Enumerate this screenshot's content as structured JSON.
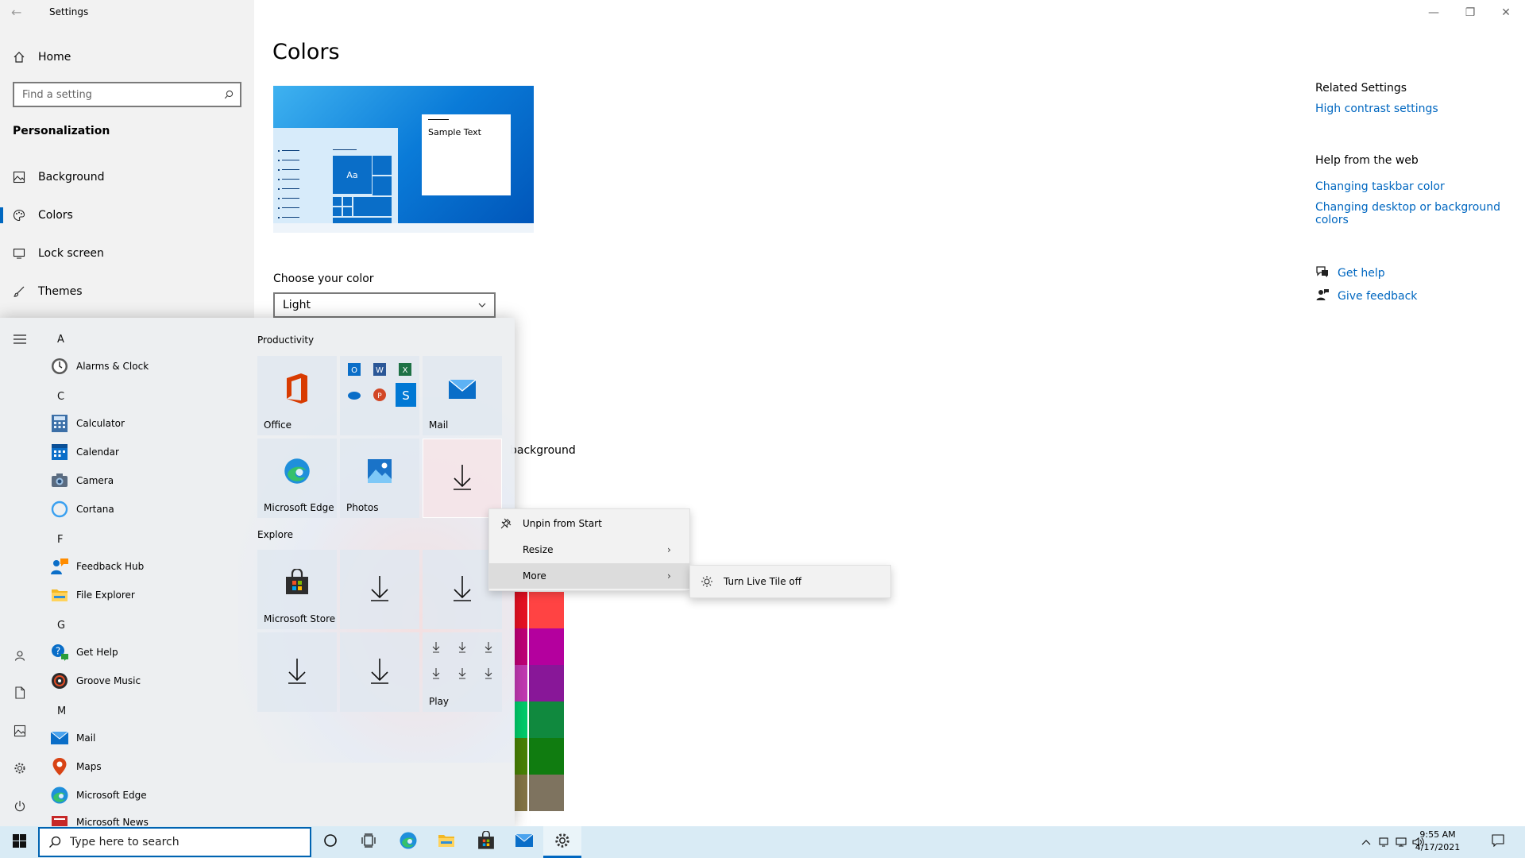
{
  "window": {
    "app_title": "Settings",
    "back_glyph": "←",
    "controls": {
      "minimize": "—",
      "restore": "❐",
      "close": "✕"
    }
  },
  "nav": {
    "home_label": "Home",
    "search_placeholder": "Find a setting",
    "section_label": "Personalization",
    "items": [
      {
        "label": "Background",
        "icon": "image-icon"
      },
      {
        "label": "Colors",
        "icon": "palette-icon",
        "active": true
      },
      {
        "label": "Lock screen",
        "icon": "monitor-icon"
      },
      {
        "label": "Themes",
        "icon": "brush-icon"
      }
    ]
  },
  "main": {
    "title": "Colors",
    "preview_sample_text": "Sample Text",
    "preview_tile_text": "Aa",
    "choose_color_label": "Choose your color",
    "choose_color_value": "Light",
    "partial_label": "background",
    "swatch_colors": [
      [
        "#e81123",
        "#ff4343"
      ],
      [
        "#bf0077",
        "#b4009e"
      ],
      [
        "#c239b3",
        "#881798"
      ],
      [
        "#00cc6a",
        "#10893e"
      ],
      [
        "#498205",
        "#107c10"
      ],
      [
        "#847545",
        "#7e735f"
      ]
    ]
  },
  "related": {
    "heading": "Related Settings",
    "high_contrast_link": "High contrast settings",
    "web_heading": "Help from the web",
    "taskbar_color_link": "Changing taskbar color",
    "desktop_color_link_line1": "Changing desktop or background",
    "desktop_color_link_line2": "colors",
    "get_help": "Get help",
    "give_feedback": "Give feedback"
  },
  "start_menu": {
    "letters": [
      "A",
      "C",
      "F",
      "G",
      "M"
    ],
    "apps": [
      {
        "label": "Alarms & Clock",
        "icon": "alarm-clock-icon"
      },
      {
        "label": "Calculator",
        "icon": "calculator-icon"
      },
      {
        "label": "Calendar",
        "icon": "calendar-icon"
      },
      {
        "label": "Camera",
        "icon": "camera-icon"
      },
      {
        "label": "Cortana",
        "icon": "cortana-icon"
      },
      {
        "label": "Feedback Hub",
        "icon": "feedback-hub-icon"
      },
      {
        "label": "File Explorer",
        "icon": "folder-icon"
      },
      {
        "label": "Get Help",
        "icon": "get-help-icon"
      },
      {
        "label": "Groove Music",
        "icon": "groove-music-icon"
      },
      {
        "label": "Mail",
        "icon": "mail-icon"
      },
      {
        "label": "Maps",
        "icon": "maps-pin-icon"
      },
      {
        "label": "Microsoft Edge",
        "icon": "edge-icon"
      },
      {
        "label": "Microsoft News",
        "icon": "news-icon"
      }
    ],
    "groups": {
      "productivity": "Productivity",
      "explore": "Explore"
    },
    "tiles": {
      "office": "Office",
      "mail": "Mail",
      "edge": "Microsoft Edge",
      "photos": "Photos",
      "store": "Microsoft Store",
      "play": "Play"
    }
  },
  "context_menu": {
    "unpin": "Unpin from Start",
    "resize": "Resize",
    "more": "More",
    "submenu_arrow": "›",
    "live_tile_off": "Turn Live Tile off"
  },
  "taskbar": {
    "search_placeholder": "Type here to search",
    "time": "9:55 AM",
    "date": "4/17/2021"
  }
}
